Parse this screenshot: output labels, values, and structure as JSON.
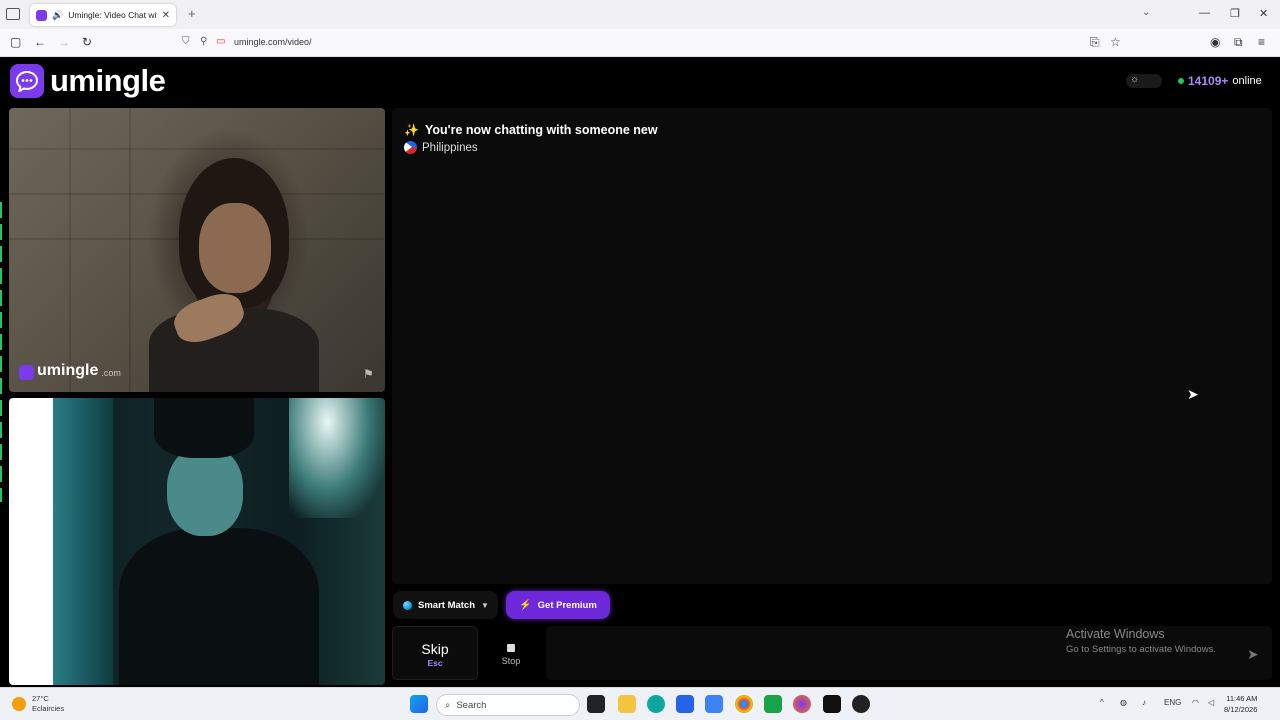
{
  "browser": {
    "tab_title": "Umingle: Video Chat with S",
    "new_tab": "+",
    "url": "umingle.com/video/"
  },
  "site": {
    "logo_text": "umingle",
    "online_count": "14109+",
    "online_label": "online"
  },
  "remote_video": {
    "watermark_text": "umingle",
    "watermark_suffix": ".com"
  },
  "chat": {
    "status_message": "You're now chatting with someone new",
    "country": "Philippines"
  },
  "controls": {
    "smart_match_label": "Smart Match",
    "premium_label": "Get Premium",
    "skip_label": "Skip",
    "skip_key": "Esc",
    "stop_label": "Stop"
  },
  "activation": {
    "title": "Activate Windows",
    "subtitle": "Go to Settings to activate Windows."
  },
  "taskbar": {
    "weather_temp": "27°C",
    "weather_desc": "Eclaircies",
    "search_placeholder": "Search",
    "language": "ENG",
    "time": "11:46 AM",
    "date": "8/12/2026"
  },
  "colors": {
    "accent": "#7c3aed",
    "online_dot": "#22c55e",
    "online_count": "#a78bfa"
  }
}
